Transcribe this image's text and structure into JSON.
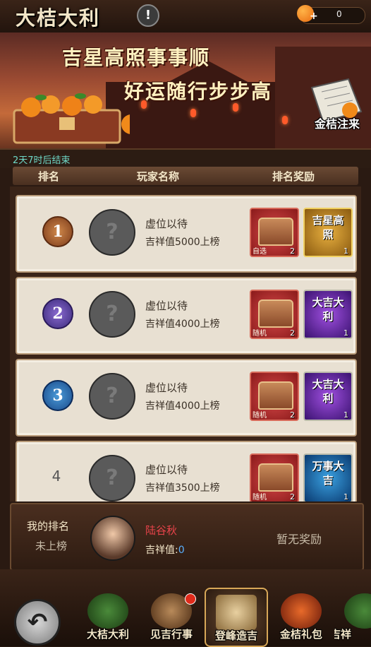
{
  "header": {
    "title": "大桔大利",
    "info_label": "!",
    "currency_value": "0",
    "plus_label": "+"
  },
  "banner": {
    "slogan_line1": "吉星高照事事顺",
    "slogan_line2": "好运随行步步高",
    "book_label": "金桔注来"
  },
  "countdown": "2天7时后结束",
  "columns": {
    "rank": "排名",
    "player": "玩家名称",
    "reward": "排名奖励"
  },
  "rows": [
    {
      "rank": "1",
      "name": "虚位以待",
      "condition": "吉祥值5000上榜",
      "chest_label": "自选",
      "chest_count": "2",
      "card_text": "吉星高照",
      "card_count": "1",
      "card_color": "gold"
    },
    {
      "rank": "2",
      "name": "虚位以待",
      "condition": "吉祥值4000上榜",
      "chest_label": "随机",
      "chest_count": "2",
      "card_text": "大吉大利",
      "card_count": "1",
      "card_color": "purple"
    },
    {
      "rank": "3",
      "name": "虚位以待",
      "condition": "吉祥值4000上榜",
      "chest_label": "随机",
      "chest_count": "2",
      "card_text": "大吉大利",
      "card_count": "1",
      "card_color": "purple"
    },
    {
      "rank": "4",
      "name": "虚位以待",
      "condition": "吉祥值3500上榜",
      "chest_label": "随机",
      "chest_count": "2",
      "card_text": "万事大吉",
      "card_count": "1",
      "card_color": "blue"
    }
  ],
  "my_rank": {
    "label": "我的排名",
    "status": "未上榜",
    "name": "陆谷秋",
    "score_label": "吉祥值:",
    "score_value": "0",
    "reward": "暂无奖励"
  },
  "nav": {
    "items": [
      "大桔大利",
      "见吉行事",
      "登峰造吉",
      "金桔礼包",
      "吉祥"
    ],
    "active_index": 2
  },
  "colors": {
    "countdown": "#6fd9c8",
    "my_name": "#e8434a",
    "score_value": "#5ab0ff"
  },
  "icons": [
    "orange-icon",
    "info-icon",
    "back-arrow-icon",
    "question-mark-avatar-icon",
    "treasure-chest-icon"
  ]
}
